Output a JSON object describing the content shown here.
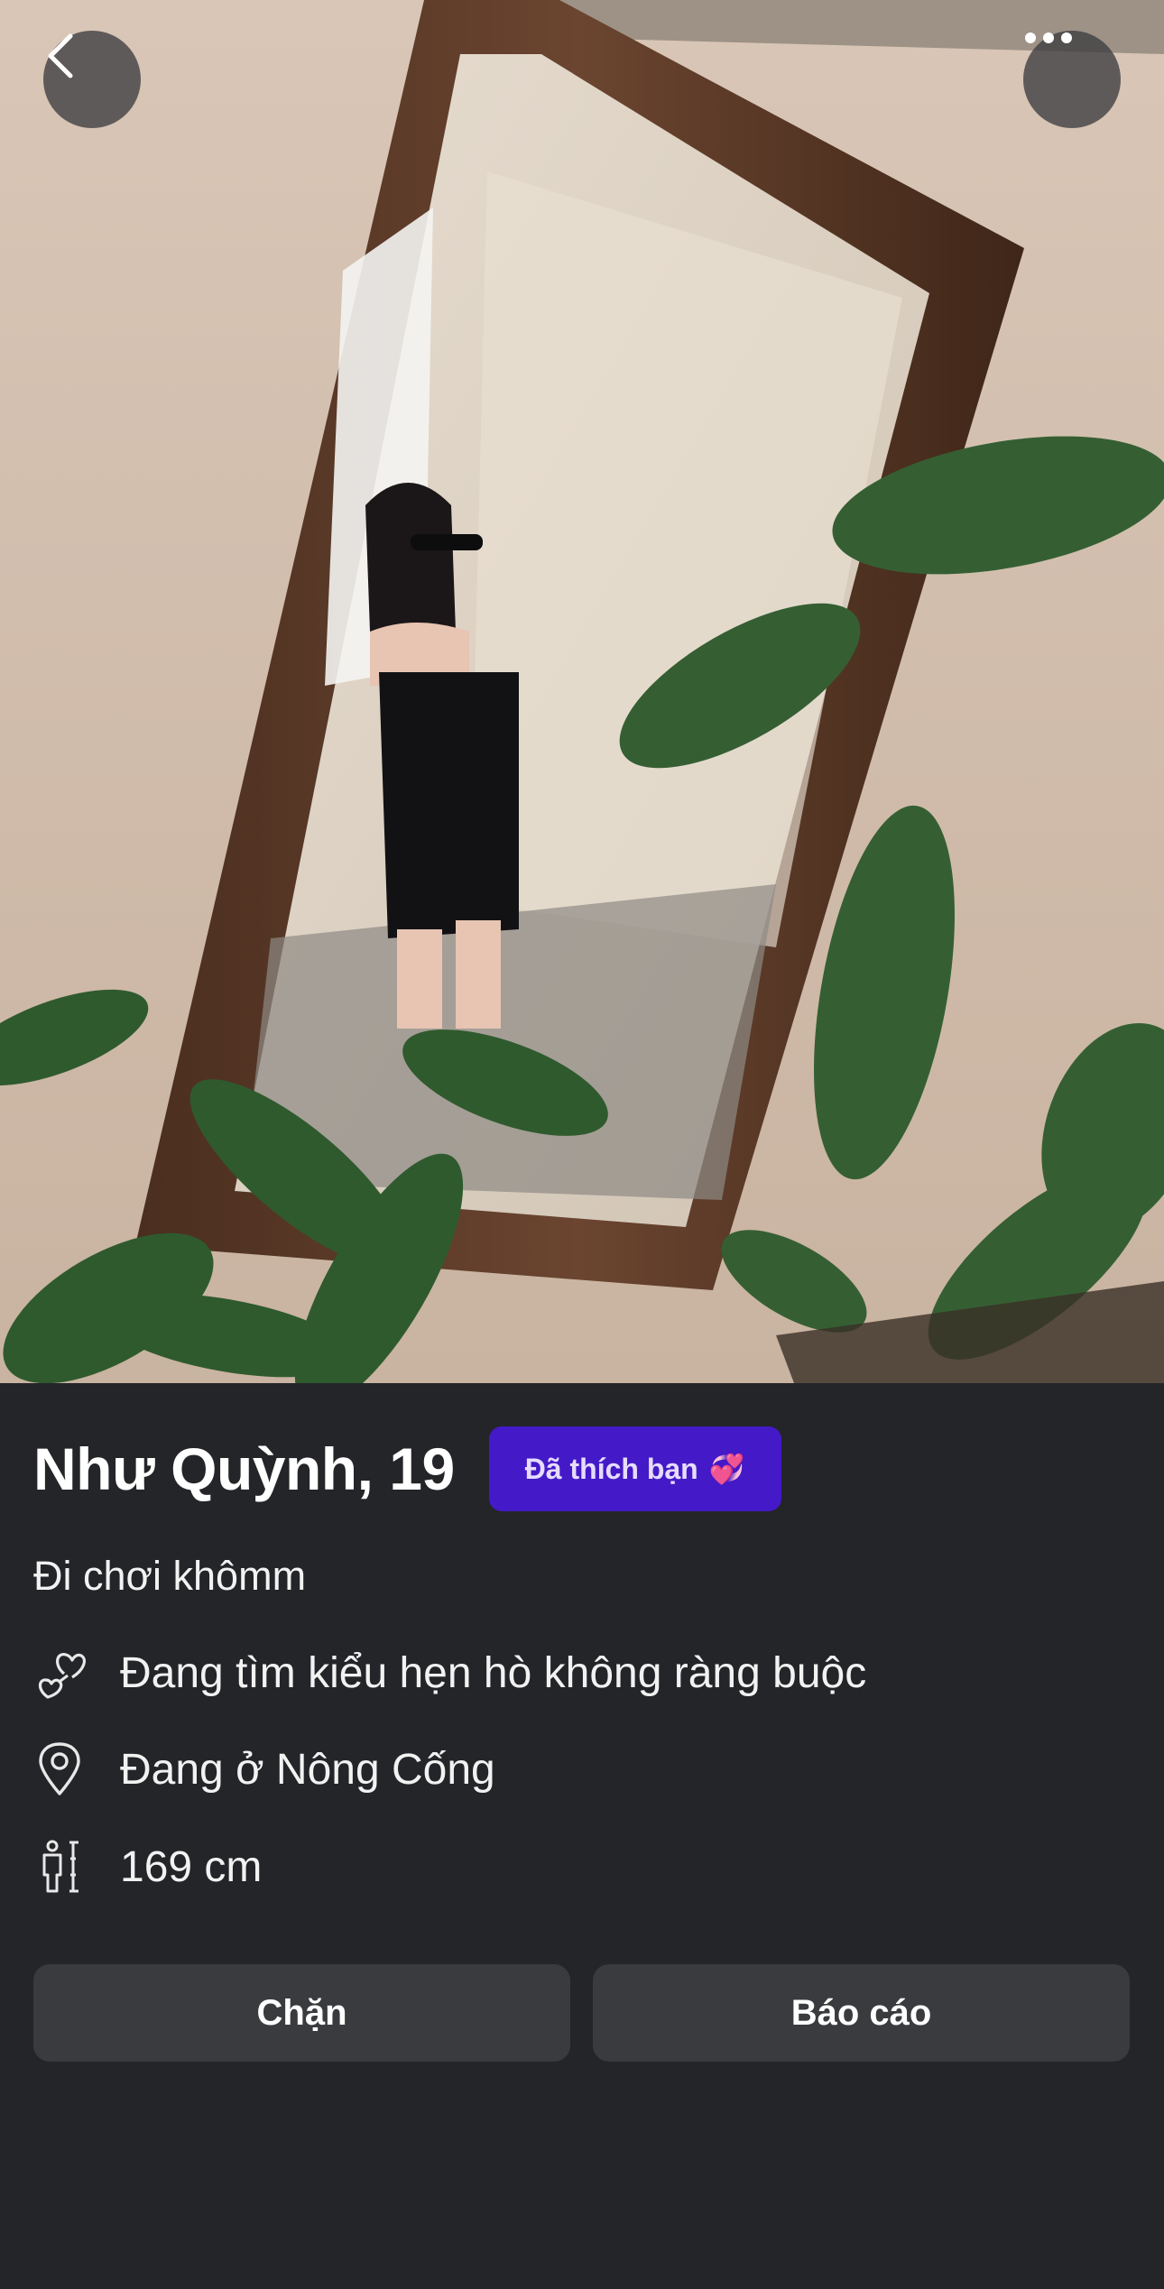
{
  "photo": {
    "description_icon": "profile-photo"
  },
  "top_bar": {
    "back_icon": "chevron-left-icon",
    "more_icon": "more-horizontal-icon"
  },
  "profile": {
    "name_age": "Như Quỳnh, 19",
    "liked_badge": "Đã thích bạn",
    "liked_badge_emoji": "💞",
    "bio": "Đi chơi khômm",
    "details": [
      {
        "icon": "hearts-icon",
        "text": "Đang tìm kiểu hẹn hò không ràng buộc"
      },
      {
        "icon": "location-pin-icon",
        "text": "Đang ở Nông Cống"
      },
      {
        "icon": "height-icon",
        "text": "169 cm"
      }
    ]
  },
  "actions": {
    "block_label": "Chặn",
    "report_label": "Báo cáo"
  },
  "colors": {
    "background": "#242528",
    "badge": "#4419c8",
    "button": "#3a3b3e"
  }
}
